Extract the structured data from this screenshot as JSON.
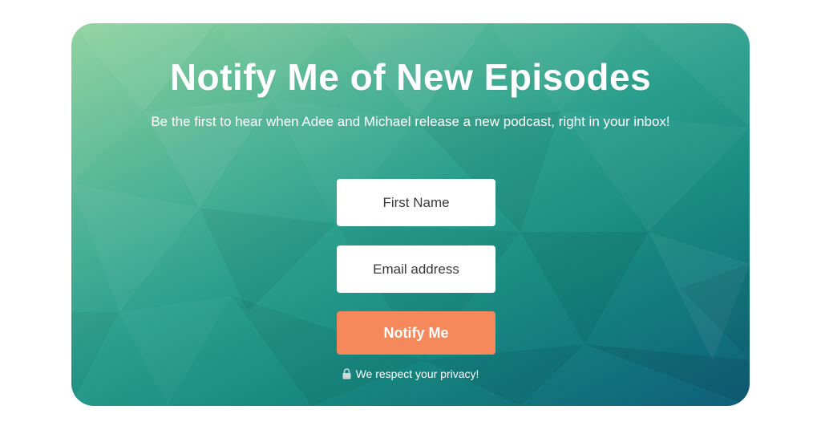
{
  "form": {
    "title": "Notify Me of New Episodes",
    "subtitle": "Be the first to hear when Adee and Michael release a new podcast, right in your inbox!",
    "first_name_placeholder": "First Name",
    "email_placeholder": "Email address",
    "submit_label": "Notify Me",
    "privacy_note": "We respect your privacy!",
    "privacy_icon": "lock-icon"
  },
  "colors": {
    "gradient_start": "#8fd29c",
    "gradient_end": "#0f5f79",
    "button": "#f5895c",
    "text": "#ffffff"
  }
}
